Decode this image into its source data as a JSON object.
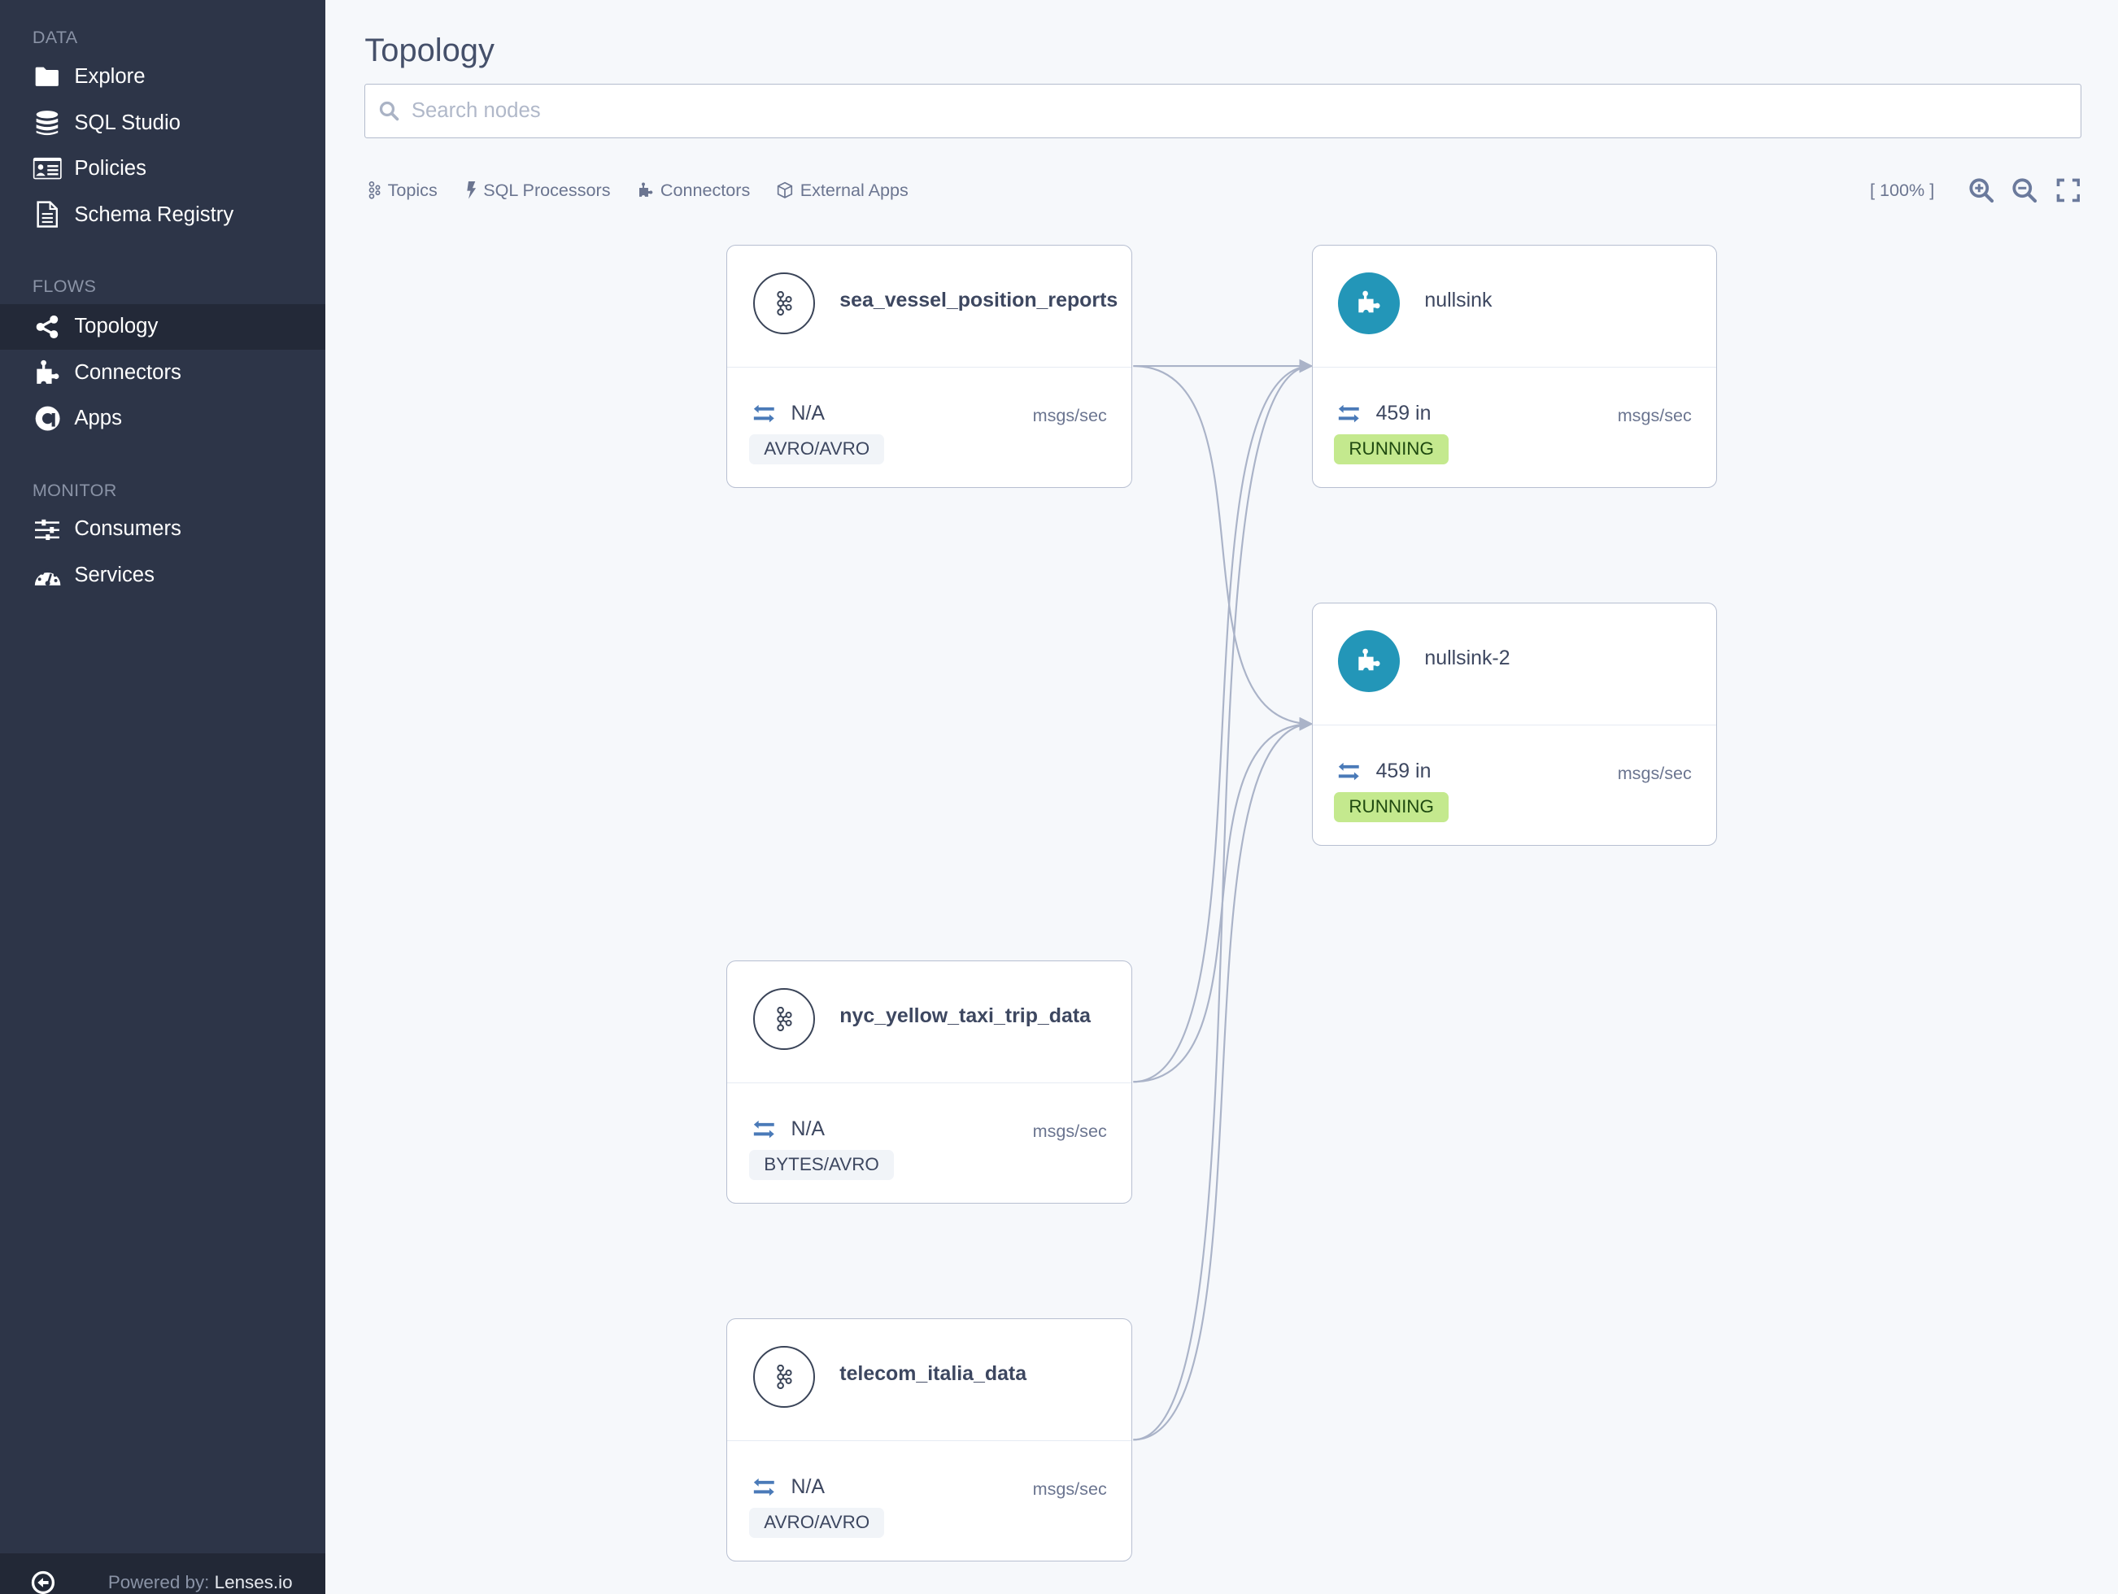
{
  "sidebar": {
    "sections": [
      {
        "label": "DATA",
        "items": [
          {
            "label": "Explore",
            "icon": "folder-icon"
          },
          {
            "label": "SQL Studio",
            "icon": "database-icon"
          },
          {
            "label": "Policies",
            "icon": "id-card-icon"
          },
          {
            "label": "Schema Registry",
            "icon": "document-icon"
          }
        ]
      },
      {
        "label": "FLOWS",
        "items": [
          {
            "label": "Topology",
            "icon": "share-icon",
            "active": true
          },
          {
            "label": "Connectors",
            "icon": "puzzle-icon"
          },
          {
            "label": "Apps",
            "icon": "apps-icon"
          }
        ]
      },
      {
        "label": "MONITOR",
        "items": [
          {
            "label": "Consumers",
            "icon": "sliders-icon"
          },
          {
            "label": "Services",
            "icon": "gauge-icon"
          }
        ]
      }
    ],
    "footer": {
      "powered_label": "Powered by:",
      "brand": "Lenses.io",
      "icon": "back-arrow-icon"
    }
  },
  "main": {
    "title": "Topology",
    "search": {
      "placeholder": "Search nodes",
      "value": ""
    },
    "filters": [
      {
        "label": "Topics",
        "icon": "kafka-icon"
      },
      {
        "label": "SQL Processors",
        "icon": "bolt-icon"
      },
      {
        "label": "Connectors",
        "icon": "puzzle-icon"
      },
      {
        "label": "External Apps",
        "icon": "cube-icon"
      }
    ],
    "zoom_level": "[ 100% ]"
  },
  "nodes": [
    {
      "id": "sea",
      "type": "topic",
      "name": "sea_vessel_position_reports",
      "rate": "N/A",
      "unit": "msgs/sec",
      "badge": "AVRO/AVRO",
      "badge_kind": "format"
    },
    {
      "id": "nyc",
      "type": "topic",
      "name": "nyc_yellow_taxi_trip_data",
      "rate": "N/A",
      "unit": "msgs/sec",
      "badge": "BYTES/AVRO",
      "badge_kind": "format"
    },
    {
      "id": "tel",
      "type": "topic",
      "name": "telecom_italia_data",
      "rate": "N/A",
      "unit": "msgs/sec",
      "badge": "AVRO/AVRO",
      "badge_kind": "format"
    },
    {
      "id": "ns1",
      "type": "connector",
      "name": "nullsink",
      "rate": "459 in",
      "unit": "msgs/sec",
      "badge": "RUNNING",
      "badge_kind": "status"
    },
    {
      "id": "ns2",
      "type": "connector",
      "name": "nullsink-2",
      "rate": "459 in",
      "unit": "msgs/sec",
      "badge": "RUNNING",
      "badge_kind": "status"
    }
  ],
  "edges": [
    {
      "from": "sea",
      "to": "ns1"
    },
    {
      "from": "sea",
      "to": "ns2"
    },
    {
      "from": "nyc",
      "to": "ns1"
    },
    {
      "from": "nyc",
      "to": "ns2"
    },
    {
      "from": "tel",
      "to": "ns1"
    },
    {
      "from": "tel",
      "to": "ns2"
    }
  ],
  "colors": {
    "sidebar_bg": "#2d3548",
    "connector_accent": "#2396b8",
    "running_bg": "#c4e98e",
    "edge": "#aab3c8",
    "rate_icon": "#4a7ab8"
  }
}
